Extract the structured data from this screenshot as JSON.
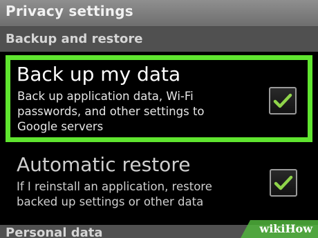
{
  "title_bar": {
    "title": "Privacy settings"
  },
  "sections": {
    "backup_header": "Backup and restore",
    "personal_header": "Personal data"
  },
  "settings": {
    "backup": {
      "title": "Back up my data",
      "summary": "Back up application data, Wi-Fi passwords, and other settings to Google servers",
      "checked": true
    },
    "restore": {
      "title": "Automatic restore",
      "summary": "If I reinstall an application, restore backed up settings or other data",
      "checked": true
    }
  },
  "highlight_color": "#5fe52f",
  "checkmark_color": "#8fd44a",
  "watermark": {
    "text": "wikiHow"
  }
}
